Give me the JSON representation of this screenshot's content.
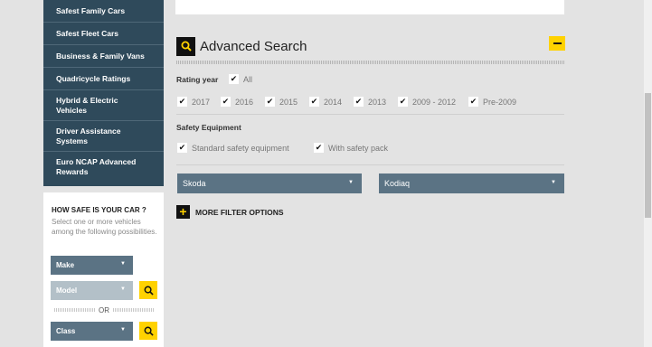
{
  "sidebar": {
    "items": [
      {
        "label": "Safest Family Cars"
      },
      {
        "label": "Safest Fleet Cars"
      },
      {
        "label": "Business & Family Vans"
      },
      {
        "label": "Quadricycle Ratings"
      },
      {
        "label": "Hybrid & Electric Vehicles"
      },
      {
        "label": "Driver Assistance Systems"
      },
      {
        "label": "Euro NCAP Advanced Rewards"
      }
    ]
  },
  "how_safe": {
    "title": "HOW SAFE IS YOUR CAR ?",
    "description": "Select one or more vehicles among the following possibilities.",
    "make_label": "Make",
    "model_label": "Model",
    "or_label": "OR",
    "class_label": "Class"
  },
  "advanced_search": {
    "title": "Advanced Search",
    "rating_year_label": "Rating year",
    "all_label": "All",
    "years": [
      "2017",
      "2016",
      "2015",
      "2014",
      "2013",
      "2009 - 2012",
      "Pre-2009"
    ],
    "safety_equipment_label": "Safety Equipment",
    "standard_label": "Standard safety equipment",
    "pack_label": "With safety pack",
    "make_value": "Skoda",
    "model_value": "Kodiaq",
    "more_filters_label": "MORE FILTER OPTIONS"
  },
  "colors": {
    "accent": "#ffd200",
    "sidebar": "#2f4a5b",
    "dropdown": "#5b7384"
  }
}
